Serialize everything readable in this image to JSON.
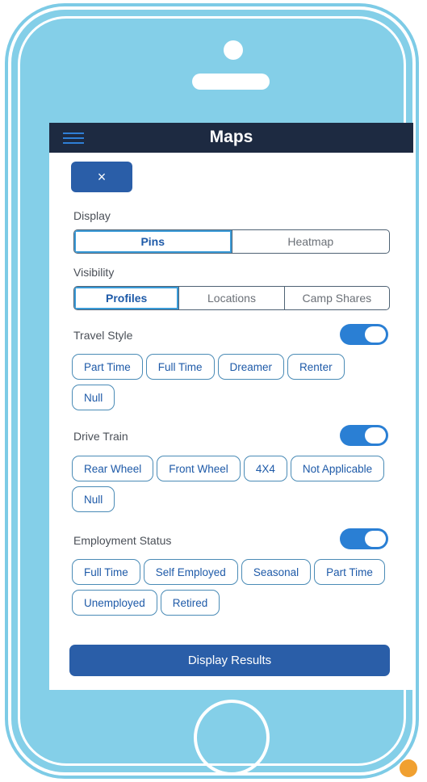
{
  "header": {
    "title": "Maps"
  },
  "close_label": "×",
  "display": {
    "label": "Display",
    "options": [
      "Pins",
      "Heatmap"
    ],
    "selected": "Pins"
  },
  "visibility": {
    "label": "Visibility",
    "options": [
      "Profiles",
      "Locations",
      "Camp Shares"
    ],
    "selected": "Profiles"
  },
  "travel_style": {
    "label": "Travel Style",
    "enabled": true,
    "chips": [
      "Part Time",
      "Full Time",
      "Dreamer",
      "Renter",
      "Null"
    ]
  },
  "drive_train": {
    "label": "Drive Train",
    "enabled": true,
    "chips": [
      "Rear Wheel",
      "Front Wheel",
      "4X4",
      "Not Applicable",
      "Null"
    ]
  },
  "employment_status": {
    "label": "Employment Status",
    "enabled": true,
    "chips": [
      "Full Time",
      "Self Employed",
      "Seasonal",
      "Part Time",
      "Unemployed",
      "Retired"
    ]
  },
  "display_results_label": "Display Results",
  "colors": {
    "accent": "#2a5ea8",
    "toggle": "#2a7fd4",
    "topbar": "#1d2a41",
    "phone": "#84cfe8"
  }
}
